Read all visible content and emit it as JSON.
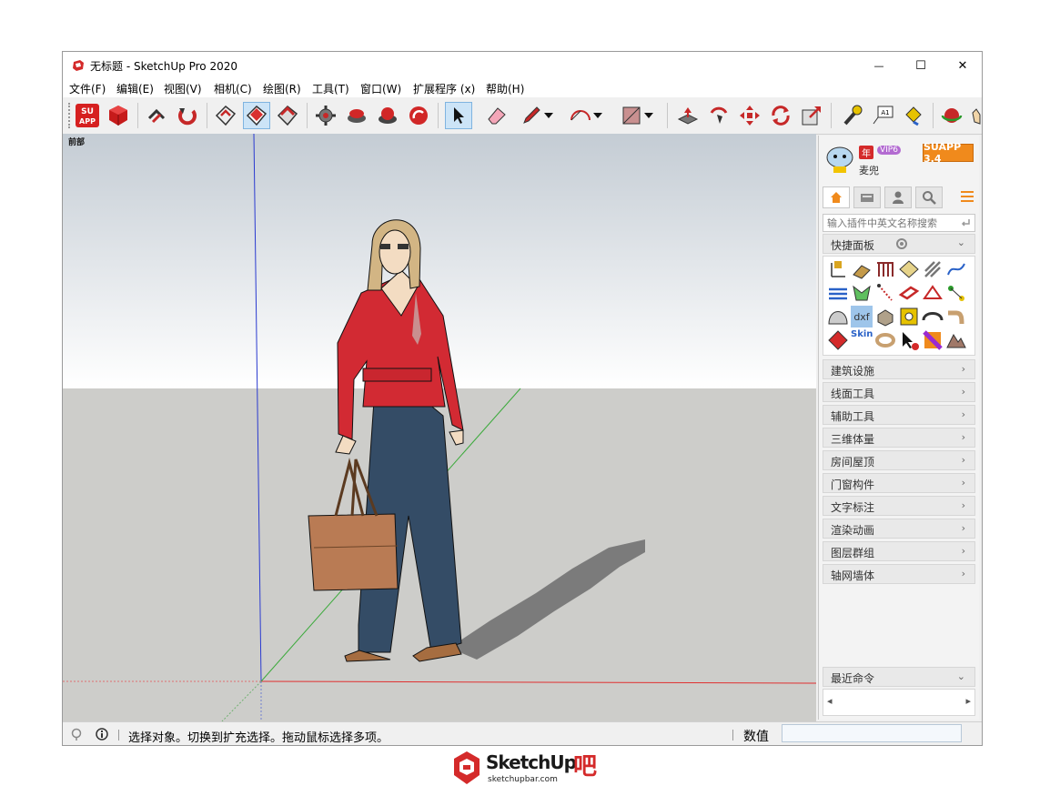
{
  "window": {
    "title": "无标题 - SketchUp Pro 2020",
    "controls": {
      "minimize": "—",
      "maximize": "☐",
      "close": "✕"
    }
  },
  "menu": [
    {
      "label": "文件(F)"
    },
    {
      "label": "编辑(E)"
    },
    {
      "label": "视图(V)"
    },
    {
      "label": "相机(C)"
    },
    {
      "label": "绘图(R)"
    },
    {
      "label": "工具(T)"
    },
    {
      "label": "窗口(W)"
    },
    {
      "label": "扩展程序 (x)"
    },
    {
      "label": "帮助(H)"
    }
  ],
  "viewport": {
    "scene_label": "前部"
  },
  "panel": {
    "user_name": "麦兜",
    "badge_year": "年",
    "badge_vip": "VIP6",
    "suapp_button": "SUAPP 3.4",
    "search_placeholder": "输入插件中英文名称搜索",
    "quick_panel": "快捷面板",
    "grid_text_dxf": "dxf",
    "grid_text_skin": "Skin",
    "categories": [
      {
        "label": "建筑设施"
      },
      {
        "label": "线面工具"
      },
      {
        "label": "辅助工具"
      },
      {
        "label": "三维体量"
      },
      {
        "label": "房间屋顶"
      },
      {
        "label": "门窗构件"
      },
      {
        "label": "文字标注"
      },
      {
        "label": "渲染动画"
      },
      {
        "label": "图层群组"
      },
      {
        "label": "轴网墙体"
      }
    ],
    "recent": "最近命令",
    "arrow_right": "›",
    "arrow_down": "⌄",
    "scroll_left": "◂",
    "scroll_right": "▸"
  },
  "status": {
    "message": "选择对象。切换到扩充选择。拖动鼠标选择多项。",
    "value_label": "数值",
    "value_input": ""
  },
  "watermark": {
    "brand": "SketchUp",
    "suffix": "吧",
    "url": "sketchupbar.com"
  },
  "colors": {
    "accent": "#cc2222",
    "sky": "#ffffff",
    "ground": "#cdcdca",
    "axis_red": "#e03030",
    "axis_green": "#3caa3c",
    "axis_blue": "#2a3ad0",
    "suapp": "#f08a1c"
  }
}
